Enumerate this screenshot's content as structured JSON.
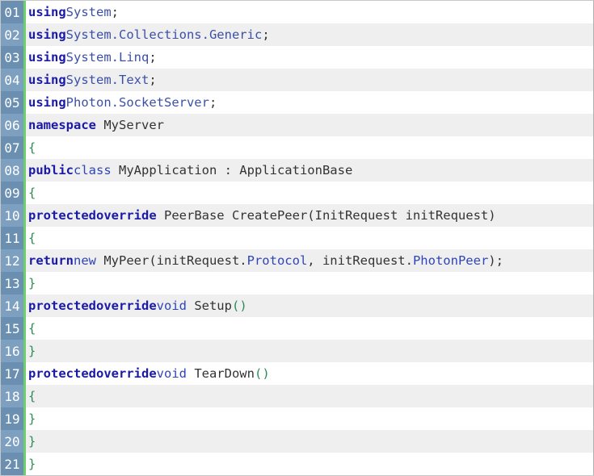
{
  "lines": [
    {
      "num": "01",
      "t": [
        [
          "kw",
          "using"
        ],
        [
          "ns",
          "System"
        ],
        [
          "punct",
          ";"
        ]
      ]
    },
    {
      "num": "02",
      "t": [
        [
          "kw",
          "using"
        ],
        [
          "ns",
          "System.Collections.Generic"
        ],
        [
          "punct",
          ";"
        ]
      ]
    },
    {
      "num": "03",
      "t": [
        [
          "kw",
          "using"
        ],
        [
          "ns",
          "System.Linq"
        ],
        [
          "punct",
          ";"
        ]
      ]
    },
    {
      "num": "04",
      "t": [
        [
          "kw",
          "using"
        ],
        [
          "ns",
          "System.Text"
        ],
        [
          "punct",
          ";"
        ]
      ]
    },
    {
      "num": "05",
      "t": [
        [
          "kw",
          "using"
        ],
        [
          "ns",
          "Photon.SocketServer"
        ],
        [
          "punct",
          ";"
        ]
      ]
    },
    {
      "num": "06",
      "t": [
        [
          "kw",
          "namespace"
        ],
        [
          "id",
          " MyServer"
        ]
      ]
    },
    {
      "num": "07",
      "t": [
        [
          "brace",
          "{"
        ]
      ]
    },
    {
      "num": "08",
      "t": [
        [
          "kw",
          "public"
        ],
        [
          "kw2",
          "class"
        ],
        [
          "id",
          " MyApplication : ApplicationBase"
        ]
      ]
    },
    {
      "num": "09",
      "t": [
        [
          "brace",
          "{"
        ]
      ]
    },
    {
      "num": "10",
      "t": [
        [
          "kw",
          "protected"
        ],
        [
          "kw",
          "override"
        ],
        [
          "id",
          " PeerBase CreatePeer(InitRequest initRequest)"
        ]
      ]
    },
    {
      "num": "11",
      "t": [
        [
          "brace",
          "{"
        ]
      ]
    },
    {
      "num": "12",
      "t": [
        [
          "kw",
          "return"
        ],
        [
          "kw2",
          "new"
        ],
        [
          "id",
          " MyPeer(initRequest."
        ],
        [
          "prop",
          "Protocol"
        ],
        [
          "id",
          ", initRequest."
        ],
        [
          "prop",
          "PhotonPeer"
        ],
        [
          "id",
          ");"
        ]
      ]
    },
    {
      "num": "13",
      "t": [
        [
          "brace",
          "}"
        ]
      ]
    },
    {
      "num": "14",
      "t": [
        [
          "kw",
          "protected"
        ],
        [
          "kw",
          "override"
        ],
        [
          "kw2",
          "void"
        ],
        [
          "id",
          " Setup"
        ],
        [
          "brace",
          "()"
        ]
      ]
    },
    {
      "num": "15",
      "t": [
        [
          "brace",
          "{"
        ]
      ]
    },
    {
      "num": "16",
      "t": [
        [
          "brace",
          "}"
        ]
      ]
    },
    {
      "num": "17",
      "t": [
        [
          "kw",
          "protected"
        ],
        [
          "kw",
          "override"
        ],
        [
          "kw2",
          "void"
        ],
        [
          "id",
          " TearDown"
        ],
        [
          "brace",
          "()"
        ]
      ]
    },
    {
      "num": "18",
      "t": [
        [
          "brace",
          "{"
        ]
      ]
    },
    {
      "num": "19",
      "t": [
        [
          "brace",
          "}"
        ]
      ]
    },
    {
      "num": "20",
      "t": [
        [
          "brace",
          "}"
        ]
      ]
    },
    {
      "num": "21",
      "t": [
        [
          "brace",
          "}"
        ]
      ]
    }
  ],
  "colors": {
    "gutter_dark": "#6b8fb0",
    "gutter_light": "#7ea0c0",
    "gutter_border": "#6ccf6c",
    "row_alt": "#efefef",
    "keyword": "#1a1aa6"
  }
}
